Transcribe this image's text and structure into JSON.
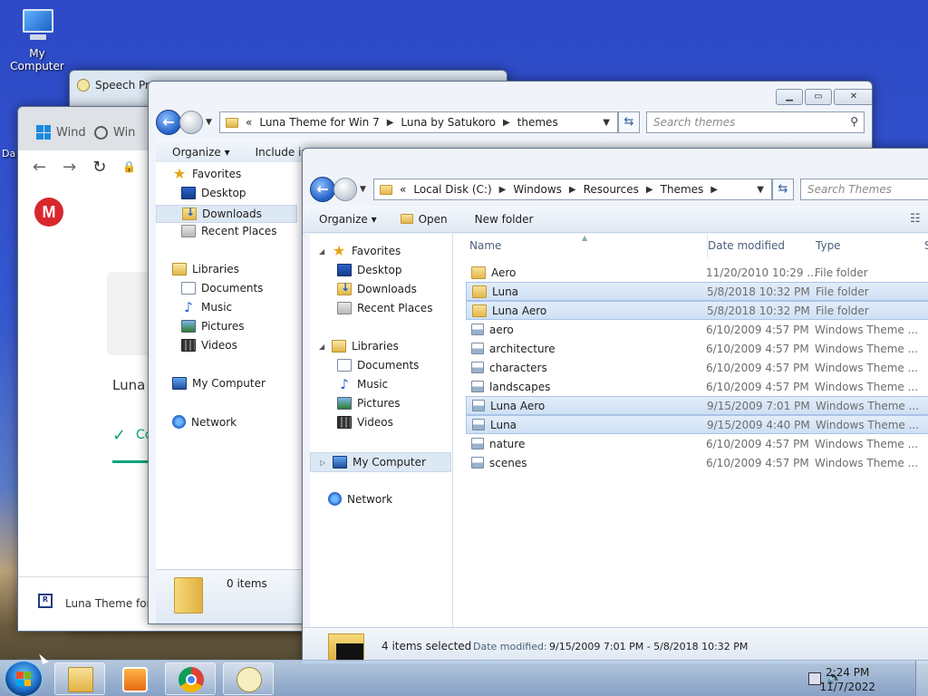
{
  "desktop": {
    "icon_label": "My Computer",
    "edge_label": "Da"
  },
  "speech_window": {
    "title": "Speech Pro"
  },
  "chrome": {
    "tab1": "Wind",
    "tab2": "Win",
    "nav": {
      "back": "←",
      "forward": "→",
      "reload": "↻",
      "lock": "🔒"
    },
    "mega_logo": "M",
    "heading": "Luna T",
    "status": "Co",
    "download_file": "Luna Theme for",
    "download_badge": "R"
  },
  "downloads_explorer": {
    "address": [
      "«",
      "Luna Theme for Win 7",
      "Luna by Satukoro",
      "themes"
    ],
    "search_placeholder": "Search themes",
    "toolbar": {
      "organize": "Organize ▾",
      "include": "Include in"
    },
    "nav": {
      "favorites": "Favorites",
      "desktop": "Desktop",
      "downloads": "Downloads",
      "recent": "Recent Places",
      "libraries": "Libraries",
      "documents": "Documents",
      "music": "Music",
      "pictures": "Pictures",
      "videos": "Videos",
      "computer": "My Computer",
      "network": "Network"
    },
    "details": {
      "count": "0 items"
    }
  },
  "themes_explorer": {
    "address": [
      "«",
      "Local Disk (C:)",
      "Windows",
      "Resources",
      "Themes"
    ],
    "search_placeholder": "Search Themes",
    "toolbar": {
      "organize": "Organize ▾",
      "open": "Open",
      "new_folder": "New folder"
    },
    "nav": {
      "favorites": "Favorites",
      "desktop": "Desktop",
      "downloads": "Downloads",
      "recent": "Recent Places",
      "libraries": "Libraries",
      "documents": "Documents",
      "music": "Music",
      "pictures": "Pictures",
      "videos": "Videos",
      "computer": "My Computer",
      "network": "Network"
    },
    "columns": {
      "name": "Name",
      "date": "Date modified",
      "type": "Type",
      "size": "S"
    },
    "files": [
      {
        "name": "Aero",
        "date": "11/20/2010 10:29 ...",
        "type": "File folder",
        "kind": "folder",
        "selected": false
      },
      {
        "name": "Luna",
        "date": "5/8/2018 10:32 PM",
        "type": "File folder",
        "kind": "folder",
        "selected": true
      },
      {
        "name": "Luna Aero",
        "date": "5/8/2018 10:32 PM",
        "type": "File folder",
        "kind": "folder",
        "selected": true
      },
      {
        "name": "aero",
        "date": "6/10/2009 4:57 PM",
        "type": "Windows Theme ...",
        "kind": "theme",
        "selected": false
      },
      {
        "name": "architecture",
        "date": "6/10/2009 4:57 PM",
        "type": "Windows Theme ...",
        "kind": "theme",
        "selected": false
      },
      {
        "name": "characters",
        "date": "6/10/2009 4:57 PM",
        "type": "Windows Theme ...",
        "kind": "theme",
        "selected": false
      },
      {
        "name": "landscapes",
        "date": "6/10/2009 4:57 PM",
        "type": "Windows Theme ...",
        "kind": "theme",
        "selected": false
      },
      {
        "name": "Luna Aero",
        "date": "9/15/2009 7:01 PM",
        "type": "Windows Theme ...",
        "kind": "theme",
        "selected": true
      },
      {
        "name": "Luna",
        "date": "9/15/2009 4:40 PM",
        "type": "Windows Theme ...",
        "kind": "theme",
        "selected": true
      },
      {
        "name": "nature",
        "date": "6/10/2009 4:57 PM",
        "type": "Windows Theme ...",
        "kind": "theme",
        "selected": false
      },
      {
        "name": "scenes",
        "date": "6/10/2009 4:57 PM",
        "type": "Windows Theme ...",
        "kind": "theme",
        "selected": false
      }
    ],
    "status": {
      "selected": "4 items selected",
      "date_label": "Date modified:",
      "date_range": "9/15/2009 7:01 PM - 5/8/2018 10:32 PM"
    }
  },
  "taskbar": {
    "time": "2:24 PM",
    "date": "11/7/2022"
  }
}
